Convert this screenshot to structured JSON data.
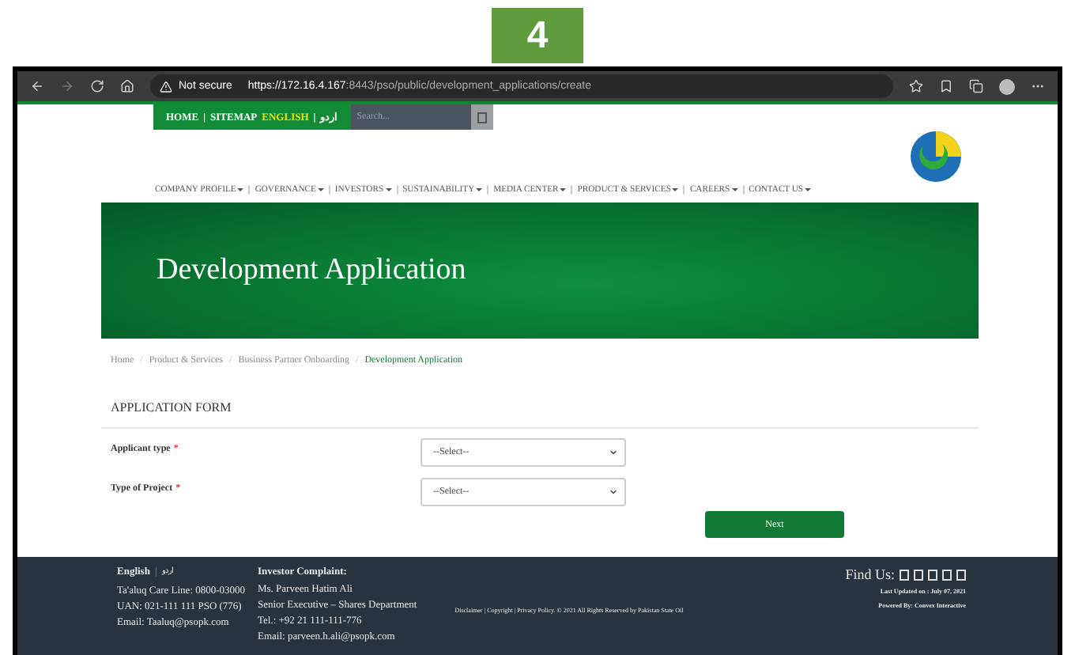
{
  "step_badge": "4",
  "browser": {
    "security_label": "Not secure",
    "url_host": "https://172.16.4.167",
    "url_rest": ":8443/pso/public/development_applications/create"
  },
  "top_bar": {
    "links": [
      {
        "label": "HOME",
        "selected": false
      },
      {
        "label": "SITEMAP",
        "separator_before": "|",
        "selected": false
      },
      {
        "label": "ENGLISH",
        "selected": true
      },
      {
        "label": "اردو",
        "separator_before": "|",
        "selected": false
      }
    ],
    "search": {
      "placeholder": "Search..."
    }
  },
  "nav": [
    "COMPANY PROFILE",
    "GOVERNANCE",
    "INVESTORS",
    "SUSTAINABILITY",
    "MEDIA CENTER",
    "PRODUCT & SERVICES",
    "CAREERS",
    "CONTACT US"
  ],
  "banner": {
    "title": "Development Application"
  },
  "breadcrumb": [
    {
      "label": "Home",
      "selected": false
    },
    {
      "label": "Product & Services",
      "selected": false
    },
    {
      "label": "Business Partner Onboarding",
      "selected": false
    },
    {
      "label": "Development Application",
      "selected": true
    }
  ],
  "breadcrumb_separator": "/",
  "form": {
    "title": "APPLICATION FORM",
    "fields": [
      {
        "label": "Applicant type",
        "required_mark": "*",
        "value": "--Select--"
      },
      {
        "label": "Type of Project",
        "required_mark": "*",
        "value": "--Select--"
      }
    ],
    "next_button": "Next"
  },
  "footer": {
    "language": {
      "english": "English",
      "separator": "|",
      "urdu": "اردو"
    },
    "contact_lines": [
      "Ta'aluq Care Line: 0800-03000",
      "UAN: 021-111 111 PSO (776)",
      "Email: Taaluq@psopk.com"
    ],
    "complaint_title": "Investor Complaint:",
    "complaint_lines": [
      "Ms. Parveen Hatim Ali",
      "Senior Executive – Shares Department",
      "Tel.: +92 21 111-111-776",
      "Email: parveen.h.ali@psopk.com"
    ],
    "legal": "Disclaimer | Copyright | Privacy Policy. © 2021 All Rights Reserved by Pakistan State Oil",
    "find_us": "Find Us:",
    "last_updated": "Last Updated on : July 07, 2021",
    "powered_by": "Powered By: Convex Interactive"
  }
}
